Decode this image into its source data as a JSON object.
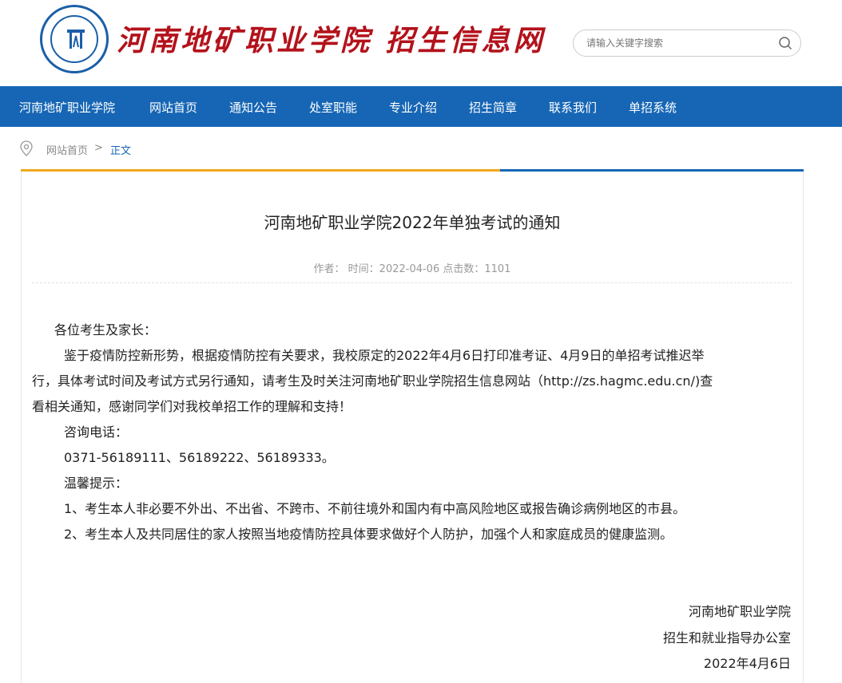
{
  "header": {
    "site_title": "河南地矿职业学院 招生信息网",
    "search_placeholder": "请输入关键字搜索"
  },
  "nav": {
    "items": [
      "河南地矿职业学院",
      "网站首页",
      "通知公告",
      "处室职能",
      "专业介绍",
      "招生简章",
      "联系我们",
      "单招系统"
    ]
  },
  "breadcrumb": {
    "home": "网站首页",
    "separator": ">",
    "current": "正文"
  },
  "article": {
    "title": "河南地矿职业学院2022年单独考试的通知",
    "meta": "作者：  时间：2022-04-06 点击数：1101",
    "greeting": "各位考生及家长：",
    "para1_line1": "鉴于疫情防控新形势，根据疫情防控有关要求，我校原定的2022年4月6日打印准考证、4月9日的单招考试推迟举",
    "para1_line2": "行，具体考试时间及考试方式另行通知，请考生及时关注河南地矿职业学院招生信息网站（http://zs.hagmc.edu.cn/)查",
    "para1_line3": "看相关通知，感谢同学们对我校单招工作的理解和支持！",
    "consult_label": "咨询电话：",
    "phones": "0371-56189111、56189222、56189333。",
    "tips_label": "温馨提示：",
    "tip1": "1、考生本人非必要不外出、不出省、不跨市、不前往境外和国内有中高风险地区或报告确诊病例地区的市县。",
    "tip2": "2、考生本人及共同居住的家人按照当地疫情防控具体要求做好个人防护，加强个人和家庭成员的健康监测。",
    "sign_org": "河南地矿职业学院",
    "sign_dept": "招生和就业指导办公室",
    "sign_date": "2022年4月6日"
  },
  "colors": {
    "nav_bg": "#1666b5",
    "title_red": "#b3121b",
    "accent_yellow": "#f0a81a"
  }
}
